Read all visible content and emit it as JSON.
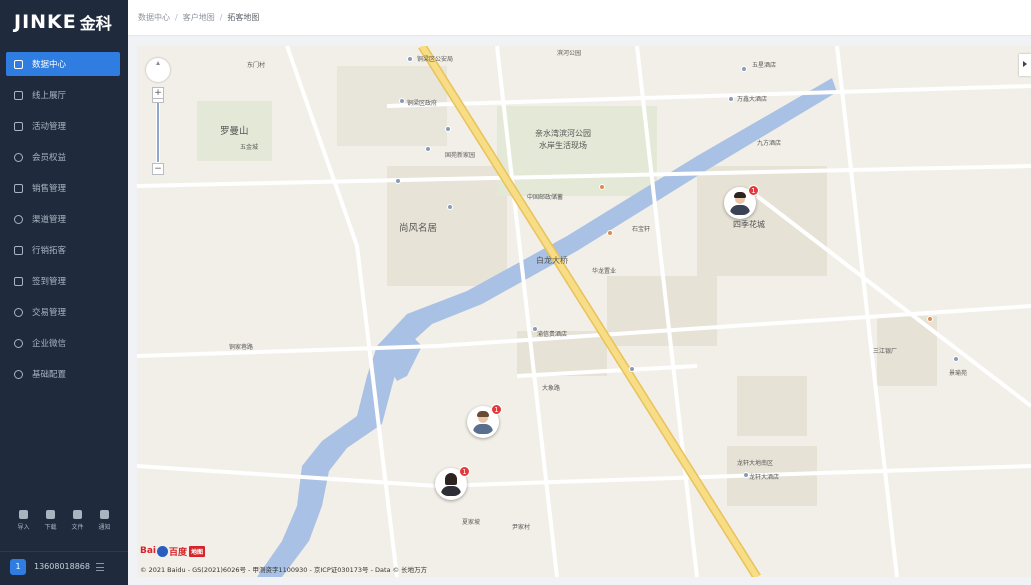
{
  "brand": {
    "logo_en": "JINKE",
    "logo_zh": "金科"
  },
  "sidebar": {
    "items": [
      {
        "label": "数据中心",
        "icon": "data-center-icon",
        "active": true
      },
      {
        "label": "线上展厅",
        "icon": "showroom-icon"
      },
      {
        "label": "活动管理",
        "icon": "activity-icon"
      },
      {
        "label": "会员权益",
        "icon": "member-icon"
      },
      {
        "label": "销售管理",
        "icon": "sales-icon"
      },
      {
        "label": "渠道管理",
        "icon": "channel-icon"
      },
      {
        "label": "行销拓客",
        "icon": "marketing-icon"
      },
      {
        "label": "签到管理",
        "icon": "signin-icon"
      },
      {
        "label": "交易管理",
        "icon": "trade-icon"
      },
      {
        "label": "企业微信",
        "icon": "wecom-icon"
      },
      {
        "label": "基础配置",
        "icon": "config-icon"
      }
    ],
    "tools": [
      {
        "label": "导入",
        "icon": "import-icon"
      },
      {
        "label": "下载",
        "icon": "download-icon"
      },
      {
        "label": "文件",
        "icon": "file-icon"
      },
      {
        "label": "通知",
        "icon": "bell-icon"
      }
    ],
    "user": {
      "avatar_text": "1",
      "phone": "13608018868"
    }
  },
  "breadcrumb": {
    "items": [
      "数据中心",
      "客户地图",
      "拓客地图"
    ]
  },
  "map": {
    "labels": {
      "luomanshan": "罗曼山",
      "shangfeng": "尚风名居",
      "qinshui": "亲水湾滨河公园",
      "shuian": "水岸生活现场",
      "bailong": "白龙大桥",
      "simei": "四季花城",
      "binhe": "滨河公园",
      "wanguo": "万鑫大酒店",
      "jiufang": "九方酒店",
      "yiyuan": "铜梁区公安局",
      "wuzhu": "五星酒店",
      "tongliang": "铜梁区政府",
      "daxiang": "大象路",
      "guoyuan": "国苑新家园",
      "longxuan": "龙轩大地南区",
      "longxuan2": "龙轩大酒店",
      "xiajia": "夏家坡",
      "yaocun": "尹家村",
      "tiankong": "三江银厂",
      "jingyu": "景瑜苑",
      "youshui": "铜家巷路",
      "zhongguo": "中国邮政储蓄",
      "hualong": "华龙置业",
      "yuxin": "渝信贵酒店",
      "shizi": "石宝轩",
      "dongmen": "东门村",
      "wugong": "五金城"
    },
    "pins": [
      {
        "name": "pin-1",
        "badge": "1"
      },
      {
        "name": "pin-2",
        "badge": "1"
      },
      {
        "name": "pin-3",
        "badge": "1"
      }
    ],
    "zoom": {
      "in_label": "+",
      "out_label": "−"
    },
    "baidu": {
      "text_left": "Bai",
      "text_right": "百度",
      "map_tag": "地图"
    },
    "copyright": "© 2021 Baidu - GS(2021)6026号 - 甲测资字1100930 - 京ICP证030173号 - Data © 长地万方"
  },
  "colors": {
    "sidebar_bg": "#1f2b3d",
    "active": "#2f7de0",
    "road_major": "#f4d36b",
    "water": "#a9c1e4",
    "park": "#dfe6d3",
    "badge": "#e5383b"
  }
}
